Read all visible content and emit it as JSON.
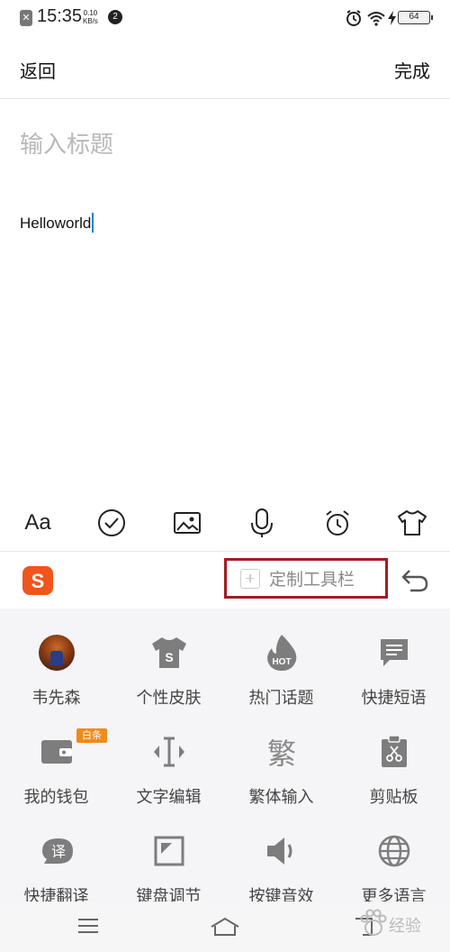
{
  "status_bar": {
    "time": "15:35",
    "speed_value": "0.10",
    "speed_unit": "KB/s",
    "badge": "2",
    "battery": "64"
  },
  "nav": {
    "back_label": "返回",
    "done_label": "完成"
  },
  "editor": {
    "title_placeholder": "输入标题",
    "body_text": "Helloworld"
  },
  "toolbar": {
    "font_label": "Aa",
    "icons": [
      "font-icon",
      "checklist-icon",
      "image-icon",
      "microphone-icon",
      "alarm-clock-icon",
      "tshirt-icon"
    ]
  },
  "ime_bar": {
    "logo_icon": "sogou-logo-icon",
    "custom_toolbar_label": "定制工具栏",
    "undo_icon": "undo-icon",
    "highlight_color": "#a01d22"
  },
  "panel": {
    "items": [
      {
        "label": "韦先森",
        "icon": "avatar"
      },
      {
        "label": "个性皮肤",
        "icon": "skin-shirt-icon"
      },
      {
        "label": "热门话题",
        "icon": "hot-topic-icon",
        "icon_text": "HOT"
      },
      {
        "label": "快捷短语",
        "icon": "quick-phrase-icon"
      },
      {
        "label": "我的钱包",
        "icon": "wallet-icon",
        "tag": "白条"
      },
      {
        "label": "文字编辑",
        "icon": "text-edit-icon"
      },
      {
        "label": "繁体输入",
        "icon": "traditional-icon",
        "icon_text": "繁"
      },
      {
        "label": "剪贴板",
        "icon": "clipboard-icon"
      },
      {
        "label": "快捷翻译",
        "icon": "translate-icon",
        "icon_text": "译"
      },
      {
        "label": "键盘调节",
        "icon": "keyboard-adjust-icon"
      },
      {
        "label": "按键音效",
        "icon": "key-sound-icon"
      },
      {
        "label": "更多语言",
        "icon": "globe-icon"
      }
    ],
    "accent_color": "#f08a1c"
  },
  "system_nav": {
    "icons": [
      "menu-icon",
      "home-icon",
      "back-icon"
    ]
  },
  "watermark": {
    "text": "经验"
  }
}
